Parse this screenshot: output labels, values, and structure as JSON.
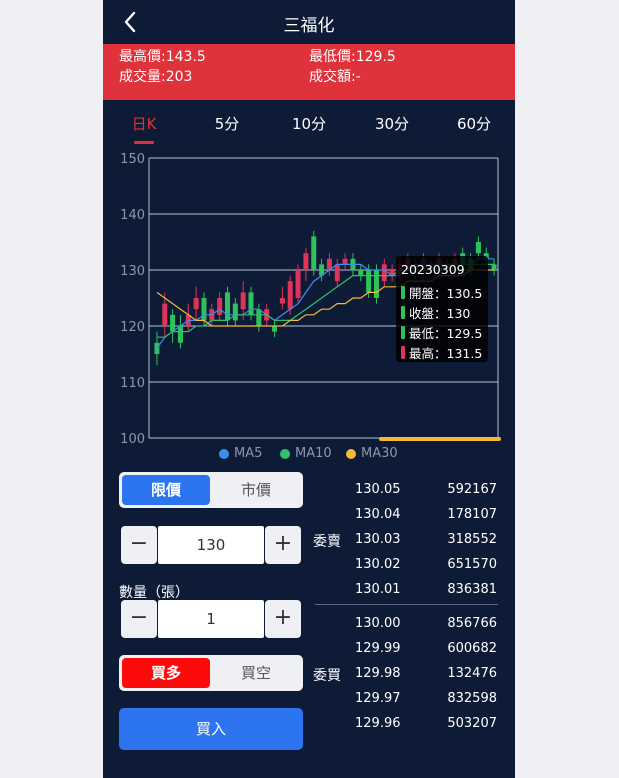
{
  "header": {
    "title": "三福化"
  },
  "stats": {
    "high": "最高價:143.5",
    "low": "最低價:129.5",
    "volume": "成交量:203",
    "turnover": "成交額:-"
  },
  "tabs": [
    {
      "label": "日K",
      "active": true
    },
    {
      "label": "5分"
    },
    {
      "label": "10分"
    },
    {
      "label": "30分"
    },
    {
      "label": "60分"
    }
  ],
  "colors": {
    "up": "#e0335a",
    "down": "#2fc25b",
    "ma5": "#3d8ef0",
    "ma10": "#2fbf6f",
    "ma30": "#f5b93a",
    "accent": "#e0323a",
    "brand": "#2d74f1"
  },
  "chart_data": {
    "type": "candlestick",
    "y_ticks": [
      "150",
      "140",
      "130",
      "120",
      "110",
      "100"
    ],
    "ylim": [
      100,
      150
    ],
    "grid": true,
    "legend": [
      "MA5",
      "MA10",
      "MA30"
    ],
    "legend_placement": "bottom",
    "candles": [
      {
        "o": 117,
        "c": 115,
        "h": 119,
        "l": 113
      },
      {
        "o": 120,
        "c": 124,
        "h": 126,
        "l": 118
      },
      {
        "o": 122,
        "c": 119,
        "h": 123,
        "l": 117
      },
      {
        "o": 120,
        "c": 117,
        "h": 122,
        "l": 116
      },
      {
        "o": 120,
        "c": 122,
        "h": 124,
        "l": 119
      },
      {
        "o": 123,
        "c": 125,
        "h": 127,
        "l": 121
      },
      {
        "o": 125,
        "c": 121,
        "h": 126,
        "l": 120
      },
      {
        "o": 121,
        "c": 123,
        "h": 124,
        "l": 120
      },
      {
        "o": 122,
        "c": 125,
        "h": 126,
        "l": 121
      },
      {
        "o": 126,
        "c": 121,
        "h": 127,
        "l": 120
      },
      {
        "o": 124,
        "c": 121,
        "h": 125,
        "l": 120
      },
      {
        "o": 123,
        "c": 126,
        "h": 128,
        "l": 121
      },
      {
        "o": 126,
        "c": 122,
        "h": 127,
        "l": 121
      },
      {
        "o": 123,
        "c": 120,
        "h": 124,
        "l": 119
      },
      {
        "o": 121,
        "c": 123,
        "h": 124,
        "l": 120
      },
      {
        "o": 120,
        "c": 119,
        "h": 121,
        "l": 118
      },
      {
        "o": 124,
        "c": 125,
        "h": 127,
        "l": 123
      },
      {
        "o": 123,
        "c": 128,
        "h": 129,
        "l": 122
      },
      {
        "o": 125,
        "c": 130,
        "h": 131,
        "l": 124
      },
      {
        "o": 130,
        "c": 133,
        "h": 134,
        "l": 128
      },
      {
        "o": 136,
        "c": 130,
        "h": 137,
        "l": 129
      },
      {
        "o": 131,
        "c": 129,
        "h": 132,
        "l": 128
      },
      {
        "o": 130,
        "c": 132,
        "h": 133,
        "l": 129
      },
      {
        "o": 128,
        "c": 131,
        "h": 132,
        "l": 127
      },
      {
        "o": 131,
        "c": 132,
        "h": 133,
        "l": 130
      },
      {
        "o": 132,
        "c": 130,
        "h": 133,
        "l": 129
      },
      {
        "o": 130,
        "c": 129,
        "h": 131,
        "l": 128
      },
      {
        "o": 130,
        "c": 126,
        "h": 131,
        "l": 125
      },
      {
        "o": 130,
        "c": 125,
        "h": 131,
        "l": 124
      },
      {
        "o": 128,
        "c": 131,
        "h": 132,
        "l": 127
      },
      {
        "o": 129,
        "c": 130,
        "h": 131,
        "l": 128
      },
      {
        "o": 129,
        "c": 131,
        "h": 132,
        "l": 128
      },
      {
        "o": 130,
        "c": 132,
        "h": 133,
        "l": 129
      },
      {
        "o": 130,
        "c": 131,
        "h": 132,
        "l": 129
      },
      {
        "o": 130,
        "c": 132,
        "h": 133,
        "l": 129
      },
      {
        "o": 130.5,
        "c": 130,
        "h": 131.5,
        "l": 129.5
      },
      {
        "o": 131,
        "c": 132,
        "h": 133,
        "l": 130
      },
      {
        "o": 130,
        "c": 131,
        "h": 132,
        "l": 129
      },
      {
        "o": 131,
        "c": 132,
        "h": 133,
        "l": 130
      },
      {
        "o": 133,
        "c": 131,
        "h": 134,
        "l": 130
      },
      {
        "o": 132,
        "c": 130,
        "h": 133,
        "l": 129
      },
      {
        "o": 135,
        "c": 133,
        "h": 136,
        "l": 132
      },
      {
        "o": 133,
        "c": 132,
        "h": 134,
        "l": 131
      },
      {
        "o": 131,
        "c": 130,
        "h": 132,
        "l": 129
      }
    ],
    "ma5": [
      116,
      118,
      119,
      120,
      121,
      121,
      122,
      122,
      123,
      122,
      122,
      122,
      123,
      123,
      122,
      121,
      122,
      123,
      124,
      126,
      128,
      129,
      130,
      131,
      131,
      131,
      131,
      130,
      130,
      130,
      129,
      129,
      130,
      131,
      131,
      131,
      131,
      131,
      131,
      131,
      131,
      132,
      132,
      132
    ],
    "ma10": [
      118,
      118,
      119,
      119,
      119,
      120,
      120,
      121,
      121,
      121,
      122,
      122,
      122,
      122,
      122,
      121,
      121,
      121,
      122,
      123,
      124,
      125,
      126,
      127,
      128,
      129,
      129,
      129,
      129,
      129,
      129,
      130,
      130,
      130,
      130,
      130,
      130,
      131,
      131,
      131,
      131,
      131,
      131,
      131
    ],
    "ma30": [
      126,
      125,
      124,
      123,
      122,
      121,
      121,
      120,
      120,
      120,
      120,
      120,
      120,
      120,
      120,
      120,
      120,
      121,
      121,
      122,
      122,
      123,
      123,
      124,
      124,
      125,
      125,
      126,
      126,
      127,
      127,
      127,
      128,
      128,
      128,
      128,
      129,
      129,
      129,
      129,
      130,
      130,
      130,
      130
    ],
    "tooltip": {
      "date": "20230309",
      "open": "開盤：130.5",
      "close": "收盤：130",
      "low": "最低：129.5",
      "high": "最高：131.5"
    }
  },
  "trade": {
    "order_type": {
      "limit": "限價",
      "market": "市價"
    },
    "price_value": "130",
    "qty_label": "數量（張）",
    "qty_value": "1",
    "minus": "−",
    "plus": "+",
    "direction": {
      "long": "買多",
      "short": "買空"
    },
    "submit": "買入"
  },
  "orderbook": {
    "ask_label": "委賣",
    "bid_label": "委買",
    "asks": [
      {
        "price": "130.05",
        "vol": "592167"
      },
      {
        "price": "130.04",
        "vol": "178107"
      },
      {
        "price": "130.03",
        "vol": "318552"
      },
      {
        "price": "130.02",
        "vol": "651570"
      },
      {
        "price": "130.01",
        "vol": "836381"
      }
    ],
    "bids": [
      {
        "price": "130.00",
        "vol": "856766"
      },
      {
        "price": "129.99",
        "vol": "600682"
      },
      {
        "price": "129.98",
        "vol": "132476"
      },
      {
        "price": "129.97",
        "vol": "832598"
      },
      {
        "price": "129.96",
        "vol": "503207"
      }
    ]
  }
}
